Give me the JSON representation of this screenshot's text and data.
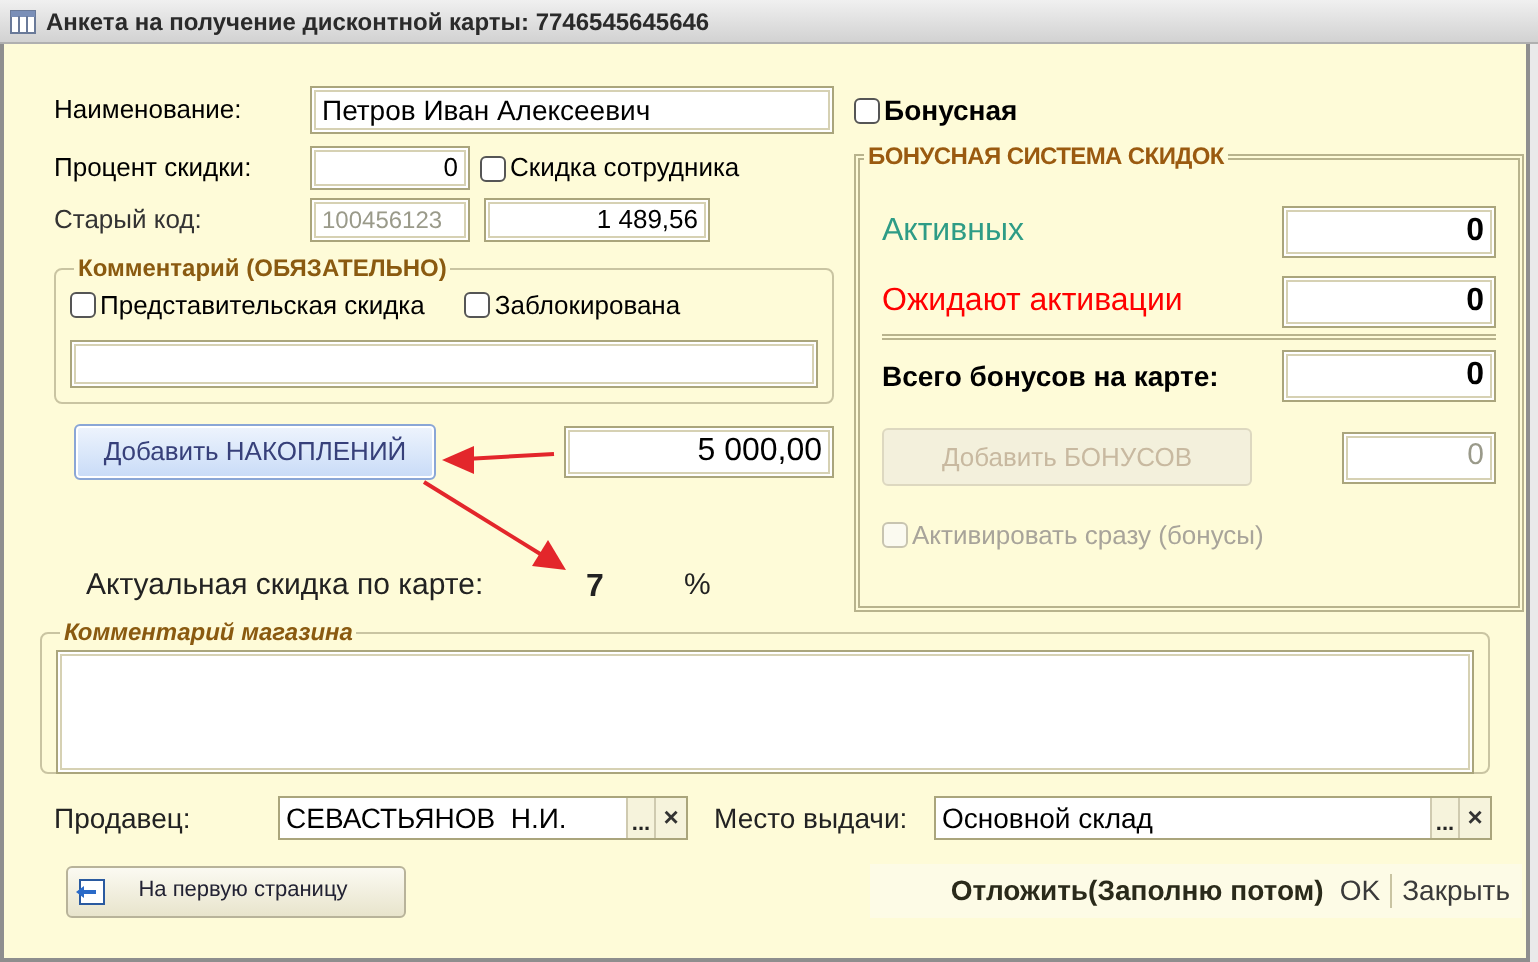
{
  "window": {
    "title": "Анкета на получение дисконтной карты: 7746545645646"
  },
  "form": {
    "name": {
      "label": "Наименование:",
      "value": "Петров Иван Алексеевич"
    },
    "discount_percent": {
      "label": "Процент скидки:",
      "value": "0"
    },
    "employee_discount": {
      "label": "Скидка сотрудника",
      "checked": false
    },
    "old_code": {
      "label": "Старый код:",
      "value": "100456123",
      "disabled": true,
      "amount": "1 489,56"
    },
    "comment_group": {
      "title": "Комментарий (ОБЯЗАТЕЛЬНО)",
      "checkboxes": [
        {
          "label": "Представительская скидка",
          "checked": false
        },
        {
          "label": "Заблокирована",
          "checked": false
        }
      ]
    },
    "add_savings": {
      "button": "Добавить НАКОПЛЕНИЙ",
      "amount": "5 000,00"
    },
    "actual_discount": {
      "label": "Актуальная скидка по карте:",
      "value": "7",
      "unit": "%"
    }
  },
  "bonus": {
    "checkbox": {
      "label": "Бонусная",
      "checked": false
    },
    "title": "БОНУСНАЯ СИСТЕМА СКИДОК",
    "rows": [
      {
        "label": "Активных",
        "value": "0",
        "color": "#2e9c86",
        "kind": "count"
      },
      {
        "label": "Ожидают активации",
        "value": "0",
        "color": "#ff0000",
        "kind": "count"
      },
      {
        "label": "Всего бонусов на карте:",
        "value": "0",
        "color": "#000000",
        "kind": "total"
      }
    ],
    "add_button": {
      "label": "Добавить БОНУСОВ",
      "disabled": true
    },
    "add_amount": {
      "value": "0",
      "disabled": true
    },
    "activate": {
      "label": "Активировать сразу (бонусы)",
      "checked": false,
      "disabled": true
    }
  },
  "store_comment": {
    "title": "Комментарий магазина"
  },
  "seller": {
    "label": "Продавец:",
    "value": "СЕВАСТЬЯНОВ  Н.И.",
    "select_button": "...",
    "clear_button": "×"
  },
  "issue_place": {
    "label": "Место выдачи:",
    "value": "Основной склад",
    "select_button": "...",
    "clear_button": "×"
  },
  "footer": {
    "back_button": "На первую страницу",
    "actions": [
      {
        "label": "Отложить(Заполню потом)",
        "kind": "default"
      },
      {
        "label": "OK",
        "kind": "plain"
      },
      {
        "label": "Закрыть",
        "kind": "plain"
      }
    ]
  }
}
